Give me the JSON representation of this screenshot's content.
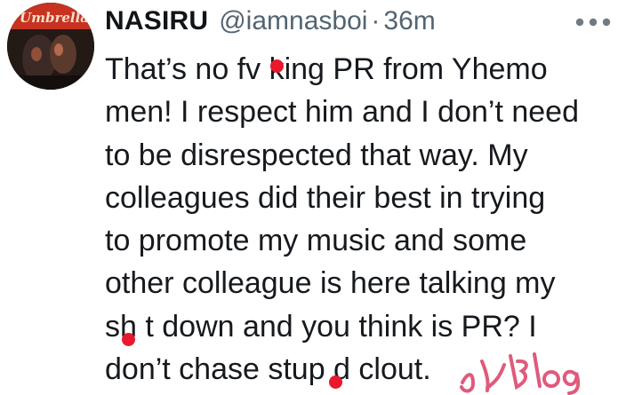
{
  "tweet": {
    "avatar_icon": "profile-avatar-artwork",
    "name": "NASIRU",
    "handle": "@iamnasboi",
    "separator": "·",
    "time": "36m",
    "more_icon": "more-options-icon",
    "text": "That’s no fv  king PR from Yhemo\nmen! I respect him and I don’t need\nto be disrespected that way. My\ncolleagues did their best in trying\nto promote my music and some\nother colleague is here talking my\nsh t down and you think is PR? I\ndon’t chase stup d clout.",
    "censor_color": "#e8192c",
    "watermark_icon": "handwritten-blog-watermark"
  }
}
